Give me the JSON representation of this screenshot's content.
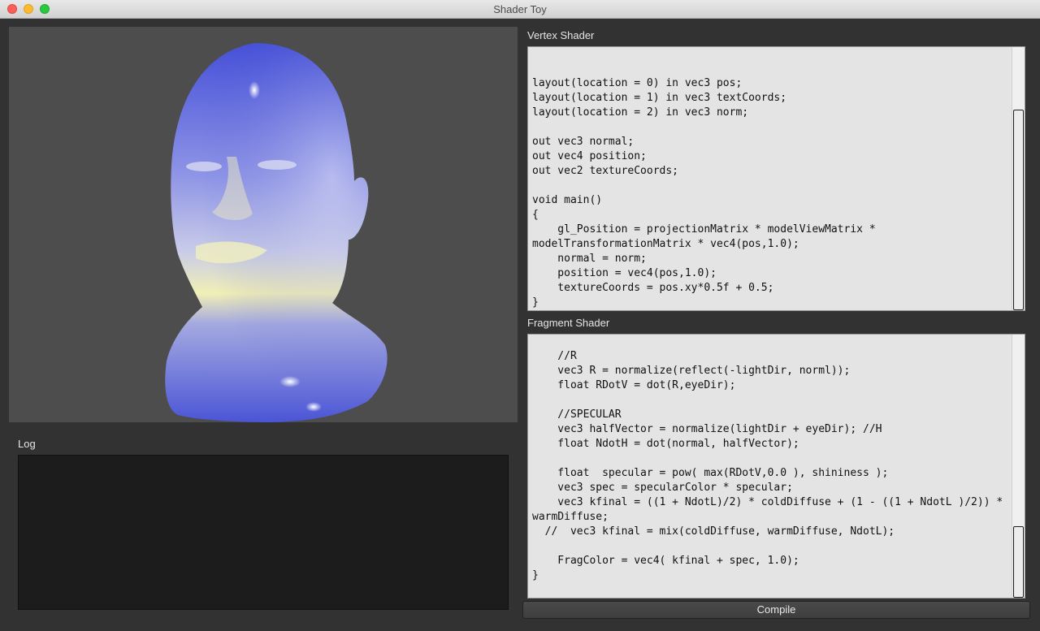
{
  "window": {
    "title": "Shader Toy"
  },
  "viewport": {
    "model": "3D head model shaded with Gooch lighting"
  },
  "log": {
    "label": "Log",
    "content": ""
  },
  "vertex_shader": {
    "label": "Vertex Shader",
    "code": "\n\nlayout(location = 0) in vec3 pos;\nlayout(location = 1) in vec3 textCoords;\nlayout(location = 2) in vec3 norm;\n\nout vec3 normal;\nout vec4 position;\nout vec2 textureCoords;\n\nvoid main()\n{\n    gl_Position = projectionMatrix * modelViewMatrix *\nmodelTransformationMatrix * vec4(pos,1.0);\n    normal = norm;\n    position = vec4(pos,1.0);\n    textureCoords = pos.xy*0.5f + 0.5;\n}"
  },
  "fragment_shader": {
    "label": "Fragment Shader",
    "code": "\n    //R\n    vec3 R = normalize(reflect(-lightDir, norml));\n    float RDotV = dot(R,eyeDir);\n\n    //SPECULAR\n    vec3 halfVector = normalize(lightDir + eyeDir); //H\n    float NdotH = dot(normal, halfVector);\n\n    float  specular = pow( max(RDotV,0.0 ), shininess );\n    vec3 spec = specularColor * specular;\n    vec3 kfinal = ((1 + NdotL)/2) * coldDiffuse + (1 - ((1 + NdotL )/2)) *\nwarmDiffuse;\n  //  vec3 kfinal = mix(coldDiffuse, warmDiffuse, NdotL);\n\n    FragColor = vec4( kfinal + spec, 1.0);\n}"
  },
  "compile_button": {
    "label": "Compile"
  },
  "colors": {
    "cold": "#4a55d6",
    "warm": "#f2f0b0",
    "background": "#323232"
  }
}
